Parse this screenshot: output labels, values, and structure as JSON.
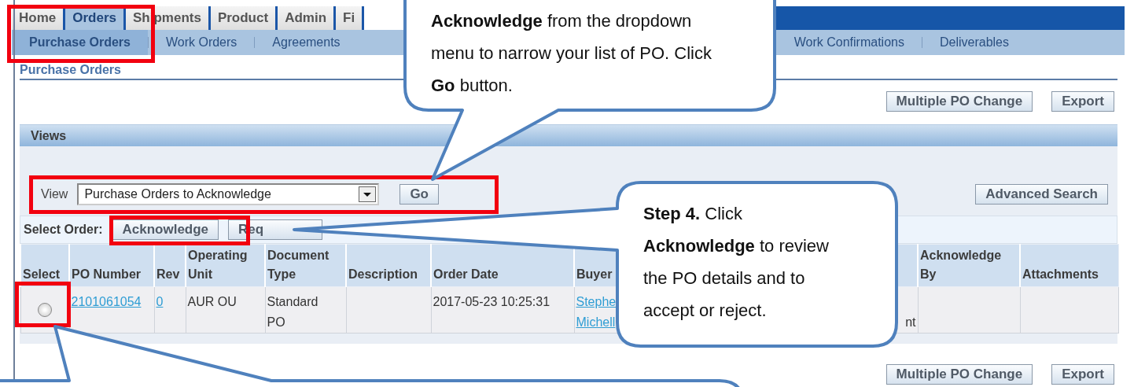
{
  "tabs": [
    {
      "label": "Home",
      "selected": false
    },
    {
      "label": "Orders",
      "selected": true
    },
    {
      "label": "Shipments",
      "selected": false
    },
    {
      "label": "Product",
      "selected": false
    },
    {
      "label": "Admin",
      "selected": false
    },
    {
      "label": "Fi",
      "selected": false
    }
  ],
  "subnav": {
    "left": [
      {
        "label": "Purchase Orders",
        "selected": true
      },
      {
        "label": "Work Orders",
        "selected": false
      },
      {
        "label": "Agreements",
        "selected": false
      }
    ],
    "right": [
      {
        "label": "Work Confirmations",
        "selected": false
      },
      {
        "label": "Deliverables",
        "selected": false
      }
    ]
  },
  "page_title": "Purchase Orders",
  "top_buttons": [
    "Multiple PO Change",
    "Export"
  ],
  "views": {
    "title": "Views",
    "view_label": "View",
    "view_value": "Purchase Orders to Acknowledge",
    "go": "Go",
    "advanced_search": "Advanced Search"
  },
  "select_order": {
    "label": "Select Order:",
    "buttons": [
      "Acknowledge",
      "Req"
    ]
  },
  "table": {
    "columns": [
      {
        "label": "Select"
      },
      {
        "label": "PO Number"
      },
      {
        "label": "Rev"
      },
      {
        "label": "Operating Unit"
      },
      {
        "label": "Document Type"
      },
      {
        "label": "Description"
      },
      {
        "label": "Order Date"
      },
      {
        "label": "Buyer"
      },
      {},
      {
        "label": "Acknowledge By"
      },
      {
        "label": "Attachments"
      }
    ],
    "rows": [
      {
        "selected": false,
        "cells": [
          {
            "kind": "radio"
          },
          {
            "kind": "link",
            "lines": [
              "2101061054"
            ]
          },
          {
            "kind": "link",
            "lines": [
              "0"
            ]
          },
          {
            "kind": "text",
            "lines": [
              "AUR OU"
            ]
          },
          {
            "kind": "text",
            "lines": [
              "Standard",
              "PO"
            ]
          },
          {
            "kind": "text"
          },
          {
            "kind": "text",
            "lines": [
              "2017-05-23 10:25:31"
            ]
          },
          {
            "kind": "link",
            "lines": [
              "Stephe",
              "Michell"
            ]
          },
          {
            "kind": "tail",
            "lines": [
              "nt"
            ]
          },
          {
            "kind": "text"
          },
          {
            "kind": "text"
          }
        ]
      }
    ]
  },
  "bottom_buttons": [
    "Multiple PO Change",
    "Export"
  ],
  "callouts": [
    {
      "text": "**Acknowledge** from the dropdown menu to narrow your list of PO. Click **Go** button."
    },
    {
      "text": "**Step 4.** Click **Acknowledge** to review the PO details and to accept or reject."
    }
  ]
}
